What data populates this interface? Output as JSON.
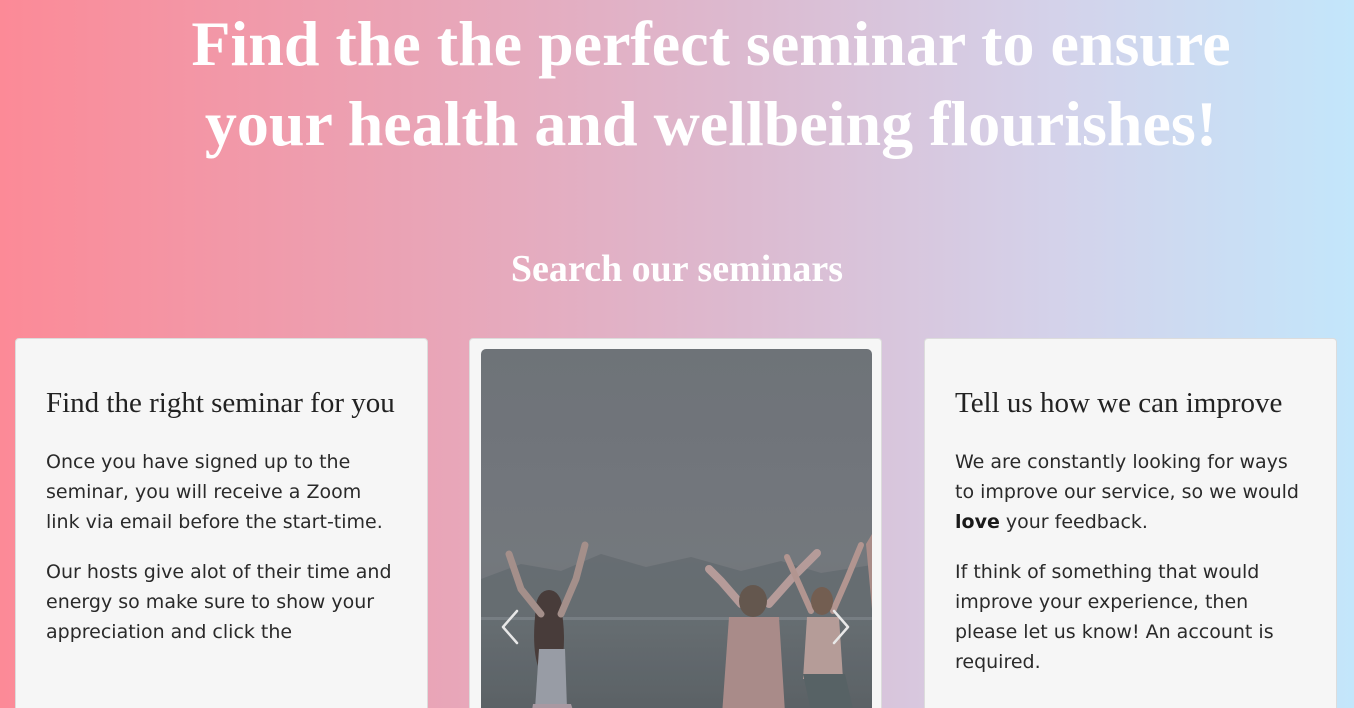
{
  "hero": {
    "title_line1": "Find the the perfect seminar to ensure",
    "title_line2": "your health and wellbeing flourishes!"
  },
  "search": {
    "title": "Search our seminars"
  },
  "card_find": {
    "heading": "Find the right seminar for you",
    "paragraph1": "Once you have signed up to the seminar, you will receive a Zoom link via email before the start-time.",
    "paragraph2": "Our hosts give alot of their time and energy so make sure to show your appreciation and click the"
  },
  "carousel": {
    "image_alt": "yoga-group-beach-photo",
    "prev_icon": "chevron-left-icon",
    "next_icon": "chevron-right-icon"
  },
  "card_improve": {
    "heading": "Tell us how we can improve",
    "p1_before": "We are constantly looking for ways to improve our service, so we would ",
    "p1_bold": "love",
    "p1_after": " your feedback.",
    "paragraph2": "If think of something that would improve your experience, then please let us know! An account is required."
  },
  "colors": {
    "gradient_left": "#fc8a97",
    "gradient_right": "#c3e6fb",
    "card_background": "#f6f6f6",
    "title_color": "#ffffff"
  }
}
